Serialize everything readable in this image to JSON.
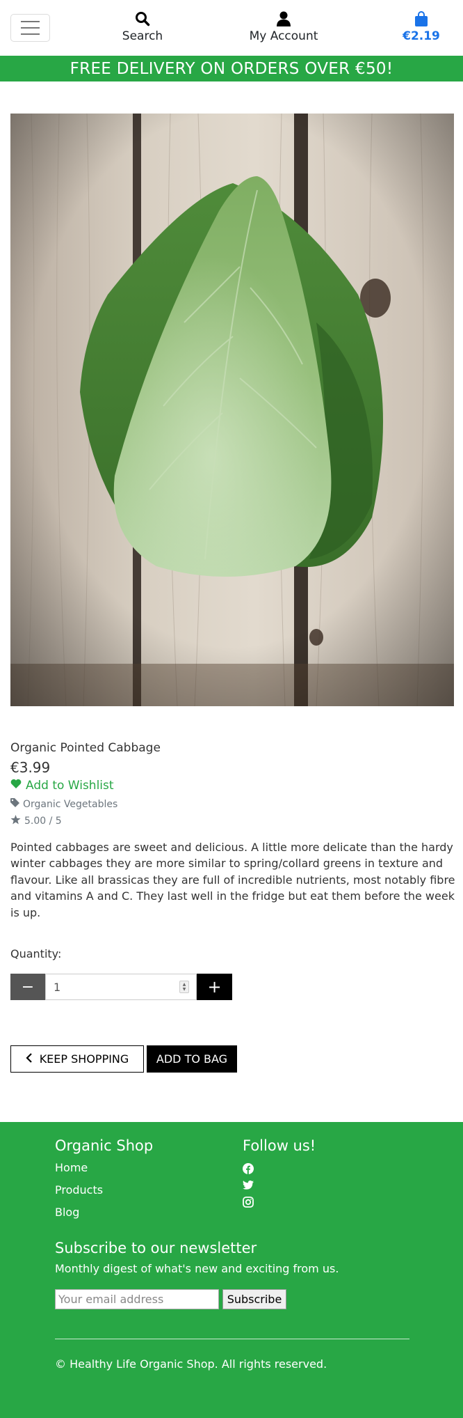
{
  "header": {
    "menu_icon": "hamburger-menu-icon",
    "search_label": "Search",
    "account_label": "My Account",
    "bag_total": "€2.19",
    "brand_color": "#28a745",
    "accent_color": "#1a73e8"
  },
  "promo": {
    "text": "FREE DELIVERY ON ORDERS OVER €50!"
  },
  "product": {
    "image_icon": "pointed-cabbage-photo",
    "name": "Organic Pointed Cabbage",
    "price": "€3.99",
    "wishlist_label": "Add to Wishlist",
    "category": "Organic Vegetables",
    "rating": "5.00 / 5",
    "description": "Pointed cabbages are sweet and delicious. A little more delicate than the hardy winter cabbages they are more similar to spring/collard greens in texture and flavour. Like all brassicas they are full of incredible nutrients, most notably fibre and vitamins A and C. They last well in the fridge but eat them before the week is up."
  },
  "quantity": {
    "label": "Quantity:",
    "value": "1",
    "minus": "−",
    "plus": "+"
  },
  "actions": {
    "keep_shopping": "KEEP SHOPPING",
    "add_to_bag": "ADD TO BAG"
  },
  "footer": {
    "shop_title": "Organic Shop",
    "links": [
      "Home",
      "Products",
      "Blog"
    ],
    "follow_title": "Follow us!",
    "social_icons": [
      "facebook-icon",
      "twitter-icon",
      "instagram-icon"
    ],
    "newsletter_title": "Subscribe to our newsletter",
    "newsletter_text": "Monthly digest of what's new and exciting from us.",
    "email_placeholder": "Your email address",
    "subscribe_label": "Subscribe",
    "copyright": "© Healthy Life Organic Shop. All rights reserved."
  }
}
